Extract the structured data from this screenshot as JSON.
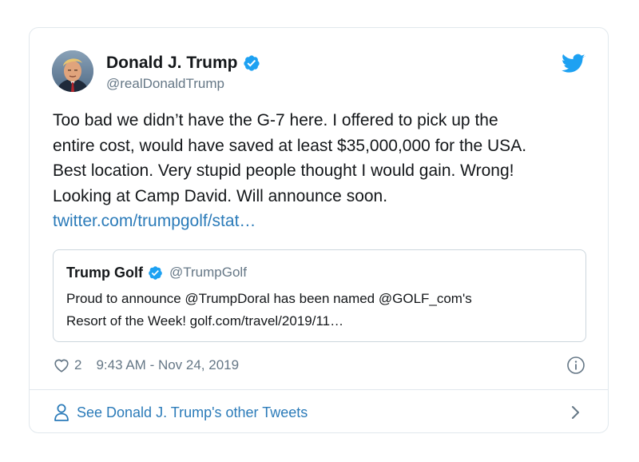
{
  "tweet": {
    "author_name": "Donald J. Trump",
    "author_handle": "@realDonaldTrump",
    "text_lines": [
      "Too bad we didn’t have the G-7 here. I offered to pick up the",
      "entire cost, would have saved at least $35,000,000 for the USA.",
      "Best location. Very stupid people thought I would gain. Wrong!",
      "Looking at Camp David. Will announce soon."
    ],
    "link_text": "twitter.com/trumpgolf/stat…",
    "like_count": "2",
    "timestamp": "9:43 AM - Nov 24, 2019"
  },
  "quoted_tweet": {
    "author_name": "Trump Golf",
    "author_handle": "@TrumpGolf",
    "text_lines": [
      "Proud to announce @TrumpDoral has been named @GOLF_com's",
      "Resort of the Week! golf.com/travel/2019/11…"
    ]
  },
  "footer": {
    "label": "See Donald J. Trump's other Tweets"
  },
  "icons": {
    "brand": "twitter-bird-icon",
    "verified": "verified-badge-icon",
    "like": "heart-icon",
    "info": "info-icon",
    "profile": "person-icon",
    "more": "chevron-right-icon"
  },
  "colors": {
    "brand_blue": "#1da1f2",
    "link_blue": "#2b7bb9",
    "text_primary": "#14171a",
    "text_secondary": "#657786",
    "border": "#e1e8ed"
  }
}
